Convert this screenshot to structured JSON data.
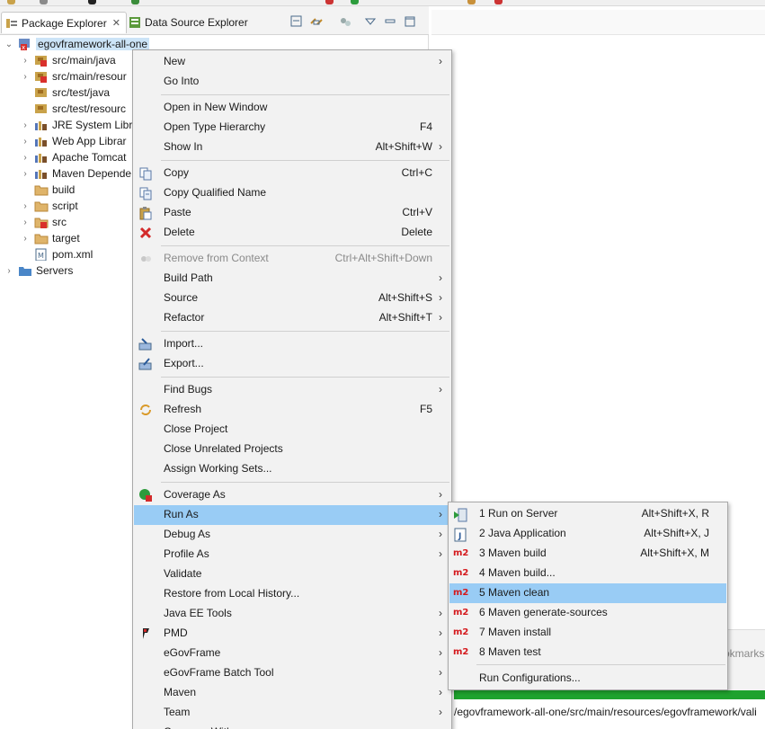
{
  "tabs": {
    "package_explorer": "Package Explorer",
    "package_explorer_close": "✕",
    "data_source_explorer": "Data Source Explorer"
  },
  "tree": {
    "project": "egovframework-all-one",
    "items": [
      {
        "label": "src/main/java",
        "icon": "source-folder-error-icon",
        "expandable": true
      },
      {
        "label": "src/main/resour",
        "icon": "source-folder-error-icon",
        "expandable": true
      },
      {
        "label": "src/test/java",
        "icon": "source-folder-icon",
        "expandable": false
      },
      {
        "label": "src/test/resourc",
        "icon": "source-folder-icon",
        "expandable": false
      },
      {
        "label": "JRE System Libr",
        "icon": "library-icon",
        "expandable": true
      },
      {
        "label": "Web App Librar",
        "icon": "library-icon",
        "expandable": true
      },
      {
        "label": "Apache Tomcat",
        "icon": "library-icon",
        "expandable": true
      },
      {
        "label": "Maven Depende",
        "icon": "library-icon",
        "expandable": true
      },
      {
        "label": "build",
        "icon": "folder-icon",
        "expandable": false
      },
      {
        "label": "script",
        "icon": "folder-icon",
        "expandable": true
      },
      {
        "label": "src",
        "icon": "folder-error-icon",
        "expandable": true
      },
      {
        "label": "target",
        "icon": "folder-icon",
        "expandable": true
      },
      {
        "label": "pom.xml",
        "icon": "maven-file-icon",
        "expandable": false
      }
    ],
    "servers": "Servers"
  },
  "context_menu": {
    "items": [
      {
        "label": "New",
        "key": "",
        "submenu": true
      },
      {
        "label": "Go Into",
        "key": "",
        "submenu": false
      },
      {
        "label": "Open in New Window",
        "key": "",
        "submenu": false
      },
      {
        "label": "Open Type Hierarchy",
        "key": "F4",
        "submenu": false
      },
      {
        "label": "Show In",
        "key": "Alt+Shift+W",
        "submenu": true
      },
      {
        "label": "Copy",
        "key": "Ctrl+C",
        "submenu": false
      },
      {
        "label": "Copy Qualified Name",
        "key": "",
        "submenu": false
      },
      {
        "label": "Paste",
        "key": "Ctrl+V",
        "submenu": false
      },
      {
        "label": "Delete",
        "key": "Delete",
        "submenu": false
      },
      {
        "label": "Remove from Context",
        "key": "Ctrl+Alt+Shift+Down",
        "submenu": false
      },
      {
        "label": "Build Path",
        "key": "",
        "submenu": true
      },
      {
        "label": "Source",
        "key": "Alt+Shift+S",
        "submenu": true
      },
      {
        "label": "Refactor",
        "key": "Alt+Shift+T",
        "submenu": true
      },
      {
        "label": "Import...",
        "key": "",
        "submenu": false
      },
      {
        "label": "Export...",
        "key": "",
        "submenu": false
      },
      {
        "label": "Find Bugs",
        "key": "",
        "submenu": true
      },
      {
        "label": "Refresh",
        "key": "F5",
        "submenu": false
      },
      {
        "label": "Close Project",
        "key": "",
        "submenu": false
      },
      {
        "label": "Close Unrelated Projects",
        "key": "",
        "submenu": false
      },
      {
        "label": "Assign Working Sets...",
        "key": "",
        "submenu": false
      },
      {
        "label": "Coverage As",
        "key": "",
        "submenu": true
      },
      {
        "label": "Run As",
        "key": "",
        "submenu": true
      },
      {
        "label": "Debug As",
        "key": "",
        "submenu": true
      },
      {
        "label": "Profile As",
        "key": "",
        "submenu": true
      },
      {
        "label": "Validate",
        "key": "",
        "submenu": false
      },
      {
        "label": "Restore from Local History...",
        "key": "",
        "submenu": false
      },
      {
        "label": "Java EE Tools",
        "key": "",
        "submenu": true
      },
      {
        "label": "PMD",
        "key": "",
        "submenu": true
      },
      {
        "label": "eGovFrame",
        "key": "",
        "submenu": true
      },
      {
        "label": "eGovFrame Batch Tool",
        "key": "",
        "submenu": true
      },
      {
        "label": "Maven",
        "key": "",
        "submenu": true
      },
      {
        "label": "Team",
        "key": "",
        "submenu": true
      },
      {
        "label": "Compare With",
        "key": "",
        "submenu": true
      }
    ],
    "arrow": "›"
  },
  "run_as_submenu": {
    "items": [
      {
        "label": "1 Run on Server",
        "key": "Alt+Shift+X, R",
        "icon": "run-on-server-icon"
      },
      {
        "label": "2 Java Application",
        "key": "Alt+Shift+X, J",
        "icon": "java-application-icon"
      },
      {
        "label": "3 Maven build",
        "key": "Alt+Shift+X, M",
        "icon": "m2-icon"
      },
      {
        "label": "4 Maven build...",
        "key": "",
        "icon": "m2-icon"
      },
      {
        "label": "5 Maven clean",
        "key": "",
        "icon": "m2-icon"
      },
      {
        "label": "6 Maven generate-sources",
        "key": "",
        "icon": "m2-icon"
      },
      {
        "label": "7 Maven install",
        "key": "",
        "icon": "m2-icon"
      },
      {
        "label": "8 Maven test",
        "key": "",
        "icon": "m2-icon"
      },
      {
        "label": "Run Configurations...",
        "key": "",
        "icon": ""
      }
    ],
    "m2_text": "m2",
    "highlighted": "5 Maven clean"
  },
  "editor": {
    "bookmarks_tab_fragment": "okmarks",
    "path_text": "/egovframework-all-one/src/main/resources/egovframework/vali"
  },
  "colors": {
    "highlight": "#99ccf5",
    "selection": "#cce4f7",
    "progress": "#1fa22e",
    "m2_red": "#d4181c"
  }
}
